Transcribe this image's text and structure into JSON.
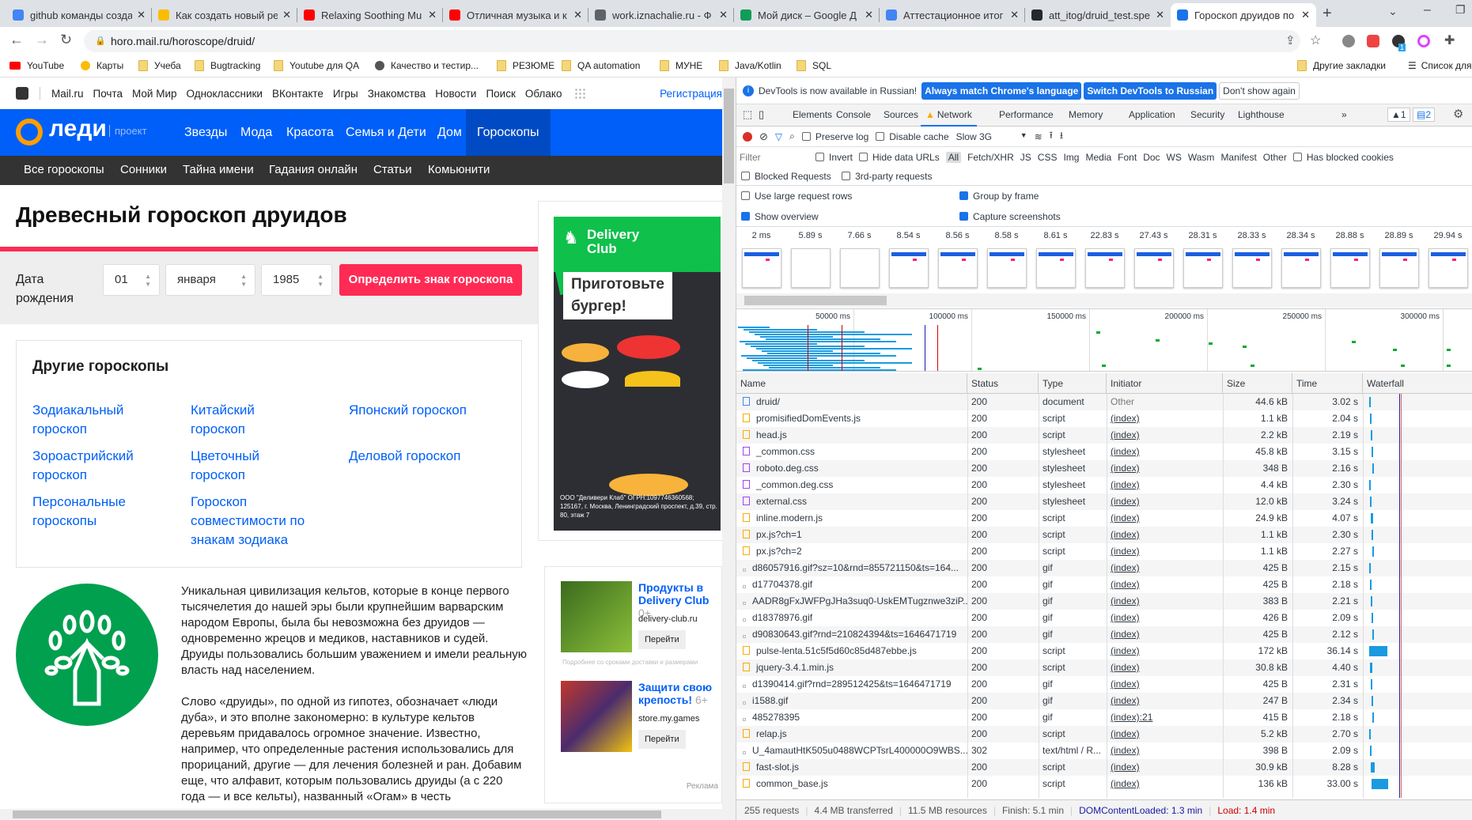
{
  "browser": {
    "tabs": [
      {
        "title": "github команды созда",
        "color": "#4285f4"
      },
      {
        "title": "Как создать новый ре",
        "color": "#fbbc04"
      },
      {
        "title": "Relaxing Soothing Mu",
        "color": "#ff0000"
      },
      {
        "title": "Отличная музыка и к",
        "color": "#ff0000"
      },
      {
        "title": "work.iznachalie.ru - Ф",
        "color": "#5f6368"
      },
      {
        "title": "Мой диск – Google Д",
        "color": "#0f9d58"
      },
      {
        "title": "Аттестационное итог",
        "color": "#4285f4"
      },
      {
        "title": "att_itog/druid_test.spe",
        "color": "#24292e"
      },
      {
        "title": "Гороскоп друидов по",
        "color": "#1a73e8"
      }
    ],
    "url": "horo.mail.ru/horoscope/druid/",
    "bookmarks": [
      "YouTube",
      "Карты",
      "Учеба",
      "Bugtracking",
      "Youtube для QA",
      "Качество и тестир...",
      "РЕЗЮМЕ",
      "QA automation",
      "МУНЕ",
      "Java/Kotlin",
      "SQL"
    ],
    "other_bookmarks": "Другие закладки",
    "reading_list": "Список для чтения",
    "ext_badge": "1"
  },
  "page": {
    "mail_links": [
      "Mail.ru",
      "Почта",
      "Мой Мир",
      "Одноклассники",
      "ВКонтакте",
      "Игры",
      "Знакомства",
      "Новости",
      "Поиск",
      "Облако"
    ],
    "register": "Регистрация",
    "logo": "леди",
    "project": "проект",
    "main_nav": [
      "Звезды",
      "Мода",
      "Красота",
      "Семья и Дети",
      "Дом",
      "Гороскопы"
    ],
    "sub_nav": [
      "Все гороскопы",
      "Сонники",
      "Тайна имени",
      "Гадания онлайн",
      "Статьи",
      "Комьюнити"
    ],
    "title": "Древесный гороскоп друидов",
    "form": {
      "label1": "Дата",
      "label2": "рождения",
      "day": "01",
      "month": "января",
      "year": "1985",
      "submit": "Определить знак гороскопа"
    },
    "other_title": "Другие гороскопы",
    "other_links": [
      "Зодиакальный гороскоп",
      "Китайский гороскоп",
      "Японский гороскоп",
      "Зороастрийский гороскоп",
      "Цветочный гороскоп",
      "Деловой гороскоп",
      "Персональные гороскопы",
      "Гороскоп совместимости по знакам зодиака"
    ],
    "body": [
      "Уникальная цивилизация кельтов, которые в конце первого тысячелетия до нашей эры были крупнейшим варварским народом Европы, была бы невозможна без друидов — одновременно жрецов и медиков, наставников и судей. Друиды пользовались большим уважением и имели реальную власть над населением.",
      "Слово «друиды», по одной из гипотез, обозначает «люди дуба», и это вполне закономерно: в культуре кельтов деревьям придавалось огромное значение. Известно, например, что определенные растения использовались для прорицаний, другие — для лечения болезней и ран. Добавим еще, что алфавит, которым пользовались друиды (а с 220 года — и все кельты), названный «Огам» в честь"
    ],
    "ad": {
      "brand": "Delivery Club",
      "headline1": "Приготовьте",
      "headline2": "бургер!",
      "legal": "ООО \"Деливери Клаб\" ОГРН:1097746360568; 125167, г. Москва, Ленинградский проспект, д.39, стр. 80, этаж 7"
    },
    "promos": [
      {
        "title": "Продукты в Delivery Club",
        "age": "0+",
        "domain": "delivery-club.ru",
        "button": "Перейти"
      },
      {
        "title": "Защити свою крепость!",
        "age": "6+",
        "domain": "store.my.games",
        "button": "Перейти"
      }
    ],
    "promo_note": "Подробнее со сроками доставки и размерами",
    "ad_label": "Реклама"
  },
  "devtools": {
    "info": "DevTools is now available in Russian!",
    "btn_match": "Always match Chrome's language",
    "btn_switch": "Switch DevTools to Russian",
    "btn_dont": "Don't show again",
    "tabs": [
      "Elements",
      "Console",
      "Sources",
      "Network",
      "Performance",
      "Memory",
      "Application",
      "Security",
      "Lighthouse"
    ],
    "active_tab": "Network",
    "warn_count": "1",
    "msg_count": "2",
    "preserve_log": "Preserve log",
    "disable_cache": "Disable cache",
    "throttle": "Slow 3G",
    "filter_placeholder": "Filter",
    "invert": "Invert",
    "hide_data": "Hide data URLs",
    "types": [
      "All",
      "Fetch/XHR",
      "JS",
      "CSS",
      "Img",
      "Media",
      "Font",
      "Doc",
      "WS",
      "Wasm",
      "Manifest",
      "Other"
    ],
    "blocked_cookies": "Has blocked cookies",
    "blocked_requests": "Blocked Requests",
    "third_party": "3rd-party requests",
    "large_rows": "Use large request rows",
    "group_frame": "Group by frame",
    "show_overview": "Show overview",
    "capture": "Capture screenshots",
    "settings": {
      "large_rows": false,
      "group_frame": true,
      "show_overview": true,
      "capture": true
    },
    "film_times": [
      "2 ms",
      "5.89 s",
      "7.66 s",
      "8.54 s",
      "8.56 s",
      "8.58 s",
      "8.61 s",
      "22.83 s",
      "27.43 s",
      "28.31 s",
      "28.33 s",
      "28.34 s",
      "28.88 s",
      "28.89 s",
      "29.94 s"
    ],
    "overview_ticks": [
      "50000 ms",
      "100000 ms",
      "150000 ms",
      "200000 ms",
      "250000 ms",
      "300000 ms"
    ],
    "columns": [
      "Name",
      "Status",
      "Type",
      "Initiator",
      "Size",
      "Time",
      "Waterfall"
    ],
    "rows": [
      {
        "name": "druid/",
        "status": "200",
        "type": "document",
        "initiator": "Other",
        "size": "44.6 kB",
        "time": "3.02 s",
        "kind": "doc"
      },
      {
        "name": "promisifiedDomEvents.js",
        "status": "200",
        "type": "script",
        "initiator": "(index)",
        "size": "1.1 kB",
        "time": "2.04 s",
        "kind": "js"
      },
      {
        "name": "head.js",
        "status": "200",
        "type": "script",
        "initiator": "(index)",
        "size": "2.2 kB",
        "time": "2.19 s",
        "kind": "js"
      },
      {
        "name": "_common.css",
        "status": "200",
        "type": "stylesheet",
        "initiator": "(index)",
        "size": "45.8 kB",
        "time": "3.15 s",
        "kind": "css"
      },
      {
        "name": "roboto.deg.css",
        "status": "200",
        "type": "stylesheet",
        "initiator": "(index)",
        "size": "348 B",
        "time": "2.16 s",
        "kind": "css"
      },
      {
        "name": "_common.deg.css",
        "status": "200",
        "type": "stylesheet",
        "initiator": "(index)",
        "size": "4.4 kB",
        "time": "2.30 s",
        "kind": "css"
      },
      {
        "name": "external.css",
        "status": "200",
        "type": "stylesheet",
        "initiator": "(index)",
        "size": "12.0 kB",
        "time": "3.24 s",
        "kind": "css"
      },
      {
        "name": "inline.modern.js",
        "status": "200",
        "type": "script",
        "initiator": "(index)",
        "size": "24.9 kB",
        "time": "4.07 s",
        "kind": "js"
      },
      {
        "name": "px.js?ch=1",
        "status": "200",
        "type": "script",
        "initiator": "(index)",
        "size": "1.1 kB",
        "time": "2.30 s",
        "kind": "js"
      },
      {
        "name": "px.js?ch=2",
        "status": "200",
        "type": "script",
        "initiator": "(index)",
        "size": "1.1 kB",
        "time": "2.27 s",
        "kind": "js"
      },
      {
        "name": "d86057916.gif?sz=10&rnd=855721150&ts=164...",
        "status": "200",
        "type": "gif",
        "initiator": "(index)",
        "size": "425 B",
        "time": "2.15 s",
        "kind": "img"
      },
      {
        "name": "d17704378.gif",
        "status": "200",
        "type": "gif",
        "initiator": "(index)",
        "size": "425 B",
        "time": "2.18 s",
        "kind": "img"
      },
      {
        "name": "AADR8gFxJWFPgJHa3suq0-UskEMTugznwe3ziP...",
        "status": "200",
        "type": "gif",
        "initiator": "(index)",
        "size": "383 B",
        "time": "2.21 s",
        "kind": "img"
      },
      {
        "name": "d18378976.gif",
        "status": "200",
        "type": "gif",
        "initiator": "(index)",
        "size": "426 B",
        "time": "2.09 s",
        "kind": "img"
      },
      {
        "name": "d90830643.gif?rnd=210824394&ts=1646471719",
        "status": "200",
        "type": "gif",
        "initiator": "(index)",
        "size": "425 B",
        "time": "2.12 s",
        "kind": "img"
      },
      {
        "name": "pulse-lenta.51c5f5d60c85d487ebbe.js",
        "status": "200",
        "type": "script",
        "initiator": "(index)",
        "size": "172 kB",
        "time": "36.14 s",
        "kind": "js"
      },
      {
        "name": "jquery-3.4.1.min.js",
        "status": "200",
        "type": "script",
        "initiator": "(index)",
        "size": "30.8 kB",
        "time": "4.40 s",
        "kind": "js"
      },
      {
        "name": "d1390414.gif?rnd=289512425&ts=1646471719",
        "status": "200",
        "type": "gif",
        "initiator": "(index)",
        "size": "425 B",
        "time": "2.31 s",
        "kind": "img"
      },
      {
        "name": "i1588.gif",
        "status": "200",
        "type": "gif",
        "initiator": "(index)",
        "size": "247 B",
        "time": "2.34 s",
        "kind": "img"
      },
      {
        "name": "485278395",
        "status": "200",
        "type": "gif",
        "initiator": "(index):21",
        "size": "415 B",
        "time": "2.18 s",
        "kind": "img"
      },
      {
        "name": "relap.js",
        "status": "200",
        "type": "script",
        "initiator": "(index)",
        "size": "5.2 kB",
        "time": "2.70 s",
        "kind": "js"
      },
      {
        "name": "U_4amautHtK505u0488WCPTsrL400000O9WBS...",
        "status": "302",
        "type": "text/html / R...",
        "initiator": "(index)",
        "size": "398 B",
        "time": "2.09 s",
        "kind": "img"
      },
      {
        "name": "fast-slot.js",
        "status": "200",
        "type": "script",
        "initiator": "(index)",
        "size": "30.9 kB",
        "time": "8.28 s",
        "kind": "js"
      },
      {
        "name": "common_base.js",
        "status": "200",
        "type": "script",
        "initiator": "(index)",
        "size": "136 kB",
        "time": "33.00 s",
        "kind": "js"
      }
    ],
    "status": {
      "requests": "255 requests",
      "transferred": "4.4 MB transferred",
      "resources": "11.5 MB resources",
      "finish": "Finish: 5.1 min",
      "dcl": "DOMContentLoaded: 1.3 min",
      "load": "Load: 1.4 min"
    }
  }
}
